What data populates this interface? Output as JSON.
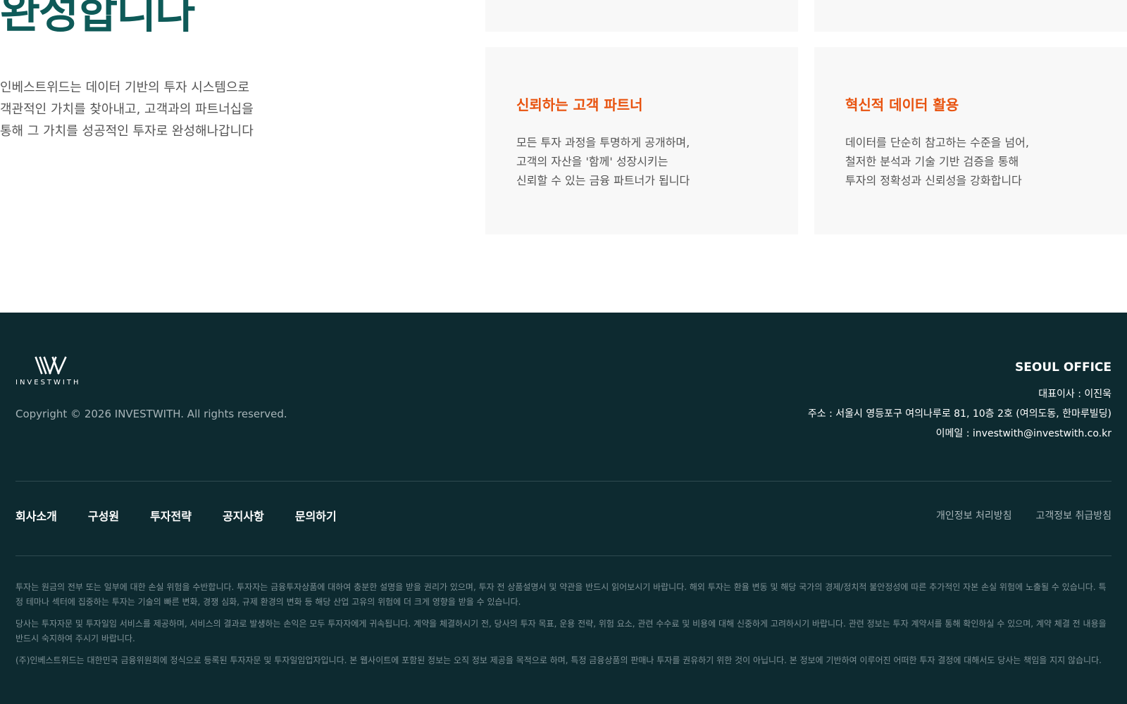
{
  "hero": {
    "title": "완성합니다",
    "desc_lines": [
      "인베스트위드는 데이터 기반의 투자 시스템으로",
      "객관적인 가치를 찾아내고, 고객과의 파트너십을",
      "통해 그 가치를 성공적인 투자로 완성해나갑니다"
    ]
  },
  "cards": [
    {
      "title": "신뢰하는 고객 파트너",
      "lines": [
        "모든 투자 과정을 투명하게 공개하며,",
        "고객의 자산을 '함께' 성장시키는",
        "신뢰할 수 있는 금융 파트너가 됩니다"
      ]
    },
    {
      "title": "혁신적 데이터 활용",
      "lines": [
        "데이터를 단순히 참고하는 수준을 넘어,",
        "철저한 분석과 기술 기반 검증을 통해",
        "투자의 정확성과 신뢰성을 강화합니다"
      ]
    }
  ],
  "footer": {
    "logo_text": "INVESTWITH",
    "logo_icon": "iw-monogram-icon",
    "copyright": "Copyright © 2026 INVESTWITH. All rights reserved.",
    "office": {
      "title": "SEOUL OFFICE",
      "ceo": "대표이사 : 이진욱",
      "address": "주소 : 서울시 영등포구 여의나루로 81, 10층 2호 (여의도동, 한마루빌딩)",
      "email": "이메일 : investwith@investwith.co.kr"
    },
    "nav": [
      "회사소개",
      "구성원",
      "투자전략",
      "공지사항",
      "문의하기"
    ],
    "policies": [
      "개인정보 처리방침",
      "고객정보 취급방침"
    ],
    "disclaimers": [
      "투자는 원금의 전부 또는 일부에 대한 손실 위험을 수반합니다. 투자자는 금융투자상품에 대하여 충분한 설명을 받을 권리가 있으며, 투자 전 상품설명서 및 약관을 반드시 읽어보시기 바랍니다. 해외 투자는 환율 변동 및 해당 국가의 경제/정치적 불안정성에 따른 추가적인 자본 손실 위험에 노출될 수 있습니다. 특정 테마나 섹터에 집중하는 투자는 기술의 빠른 변화, 경쟁 심화, 규제 환경의 변화 등 해당 산업 고유의 위험에 더 크게 영향을 받을 수 있습니다.",
      "당사는 투자자문 및 투자일임 서비스를 제공하며, 서비스의 결과로 발생하는 손익은 모두 투자자에게 귀속됩니다. 계약을 체결하시기 전, 당사의 투자 목표, 운용 전략, 위험 요소, 관련 수수료 및 비용에 대해 신중하게 고려하시기 바랍니다. 관련 정보는 투자 계약서를 통해 확인하실 수 있으며, 계약 체결 전 내용을 반드시 숙지하여 주시기 바랍니다.",
      "(주)인베스트위드는 대한민국 금융위원회에 정식으로 등록된 투자자문 및 투자일임업자입니다. 본 웹사이트에 포함된 정보는 오직 정보 제공을 목적으로 하며, 특정 금융상품의 판매나 투자를 권유하기 위한 것이 아닙니다. 본 정보에 기반하여 이루어진 어떠한 투자 결정에 대해서도 당사는 책임을 지지 않습니다."
    ]
  },
  "colors": {
    "title_teal": "#0e5a58",
    "accent_orange": "#e8530f",
    "footer_bg": "#0d2a30"
  }
}
